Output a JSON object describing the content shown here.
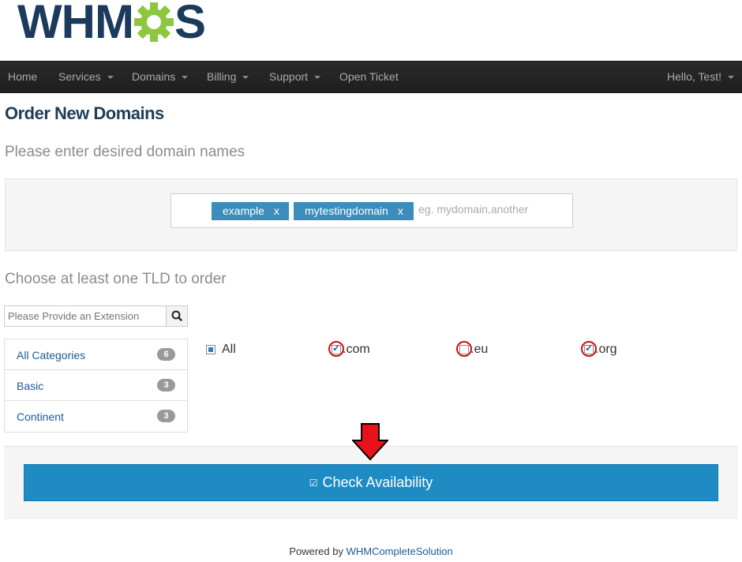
{
  "brand": {
    "logo_text_prefix": "WHM",
    "logo_text_suffix": "S",
    "logo_colors": {
      "text": "#1b3a5c",
      "gear": "#8dc63f"
    }
  },
  "nav": {
    "items": [
      {
        "label": "Home",
        "caret": false
      },
      {
        "label": "Services",
        "caret": true
      },
      {
        "label": "Domains",
        "caret": true
      },
      {
        "label": "Billing",
        "caret": true
      },
      {
        "label": "Support",
        "caret": true
      },
      {
        "label": "Open Ticket",
        "caret": false
      }
    ],
    "user_label": "Hello, Test!"
  },
  "page": {
    "title": "Order New Domains",
    "domain_prompt": "Please enter desired domain names",
    "tld_prompt": "Choose at least one TLD to order"
  },
  "domain_input": {
    "tags": [
      "example",
      "mytestingdomain"
    ],
    "remove_symbol": "x",
    "placeholder": "eg. mydomain,another"
  },
  "extension_search": {
    "placeholder": "Please Provide an Extension",
    "icon": "search-icon"
  },
  "categories": [
    {
      "label": "All Categories",
      "count": "6"
    },
    {
      "label": "Basic",
      "count": "3"
    },
    {
      "label": "Continent",
      "count": "3"
    }
  ],
  "tlds": [
    {
      "label": "All",
      "state": "partial"
    },
    {
      "label": ".com",
      "state": "checked"
    },
    {
      "label": ".eu",
      "state": "unchecked"
    },
    {
      "label": ".org",
      "state": "checked"
    }
  ],
  "check_button": {
    "label": "Check Availability",
    "icon": "check-square-icon",
    "color": "#1e8bc3"
  },
  "footer": {
    "prefix": "Powered by ",
    "link": "WHMCompleteSolution"
  }
}
